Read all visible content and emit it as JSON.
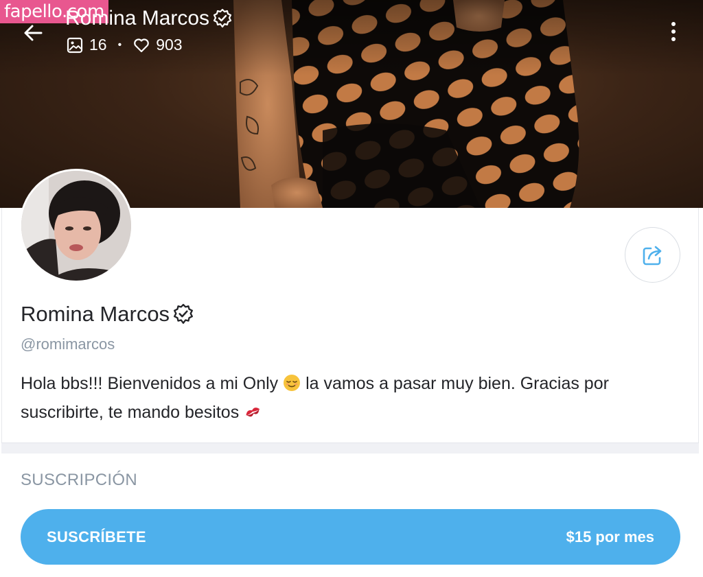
{
  "watermark": "fapello.com",
  "header": {
    "title": "Romina Marcos",
    "media_count": "16",
    "likes_count": "903",
    "stat_separator": "•"
  },
  "profile": {
    "name": "Romina Marcos",
    "handle": "@romimarcos",
    "bio_part1": "Hola bbs!!! Bienvenidos a mi Only ",
    "bio_part2": " la vamos a pasar muy bien. Gracias por suscribirte, te mando besitos "
  },
  "subscription": {
    "section_title": "SUSCRIPCIÓN",
    "button_label": "SUSCRÍBETE",
    "price": "$15 por mes"
  },
  "colors": {
    "accent": "#4eb0ec",
    "watermark_bg": "#e8578f",
    "muted_text": "#8a96a3",
    "share_icon": "#4eb0ec"
  },
  "icons": {
    "back": "arrow-left-icon",
    "verified": "verified-badge-icon",
    "media": "image-icon",
    "likes": "heart-icon",
    "menu": "more-vertical-icon",
    "share": "share-icon",
    "bio_emoji_1": "relieved-face-emoji",
    "bio_emoji_2": "kiss-mark-emoji"
  }
}
